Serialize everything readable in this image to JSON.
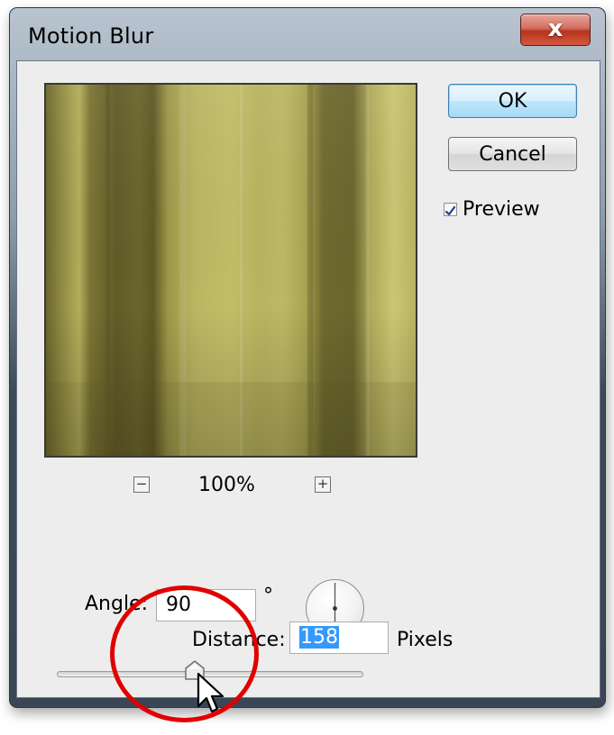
{
  "window": {
    "title": "Motion Blur",
    "close_symbol": "x"
  },
  "buttons": {
    "ok": "OK",
    "cancel": "Cancel"
  },
  "preview_checkbox": {
    "label": "Preview",
    "checked": true
  },
  "zoom": {
    "value": "100%",
    "out_symbol": "−",
    "in_symbol": "+"
  },
  "angle": {
    "label": "Angle:",
    "value": "90",
    "unit": "°"
  },
  "distance": {
    "label": "Distance:",
    "value": "158",
    "unit": "Pixels",
    "slider_position": 0.45
  },
  "colors": {
    "preview_base": "#a9a458",
    "preview_dark": "#6e6830",
    "accent_annotation": "#e00000",
    "selection": "#3399ff"
  },
  "icons": {
    "close": "close-x-icon",
    "zoom_out": "minus-icon",
    "zoom_in": "plus-icon",
    "check": "checkmark-icon",
    "dial": "angle-dial-icon",
    "pointer": "mouse-cursor-icon"
  }
}
